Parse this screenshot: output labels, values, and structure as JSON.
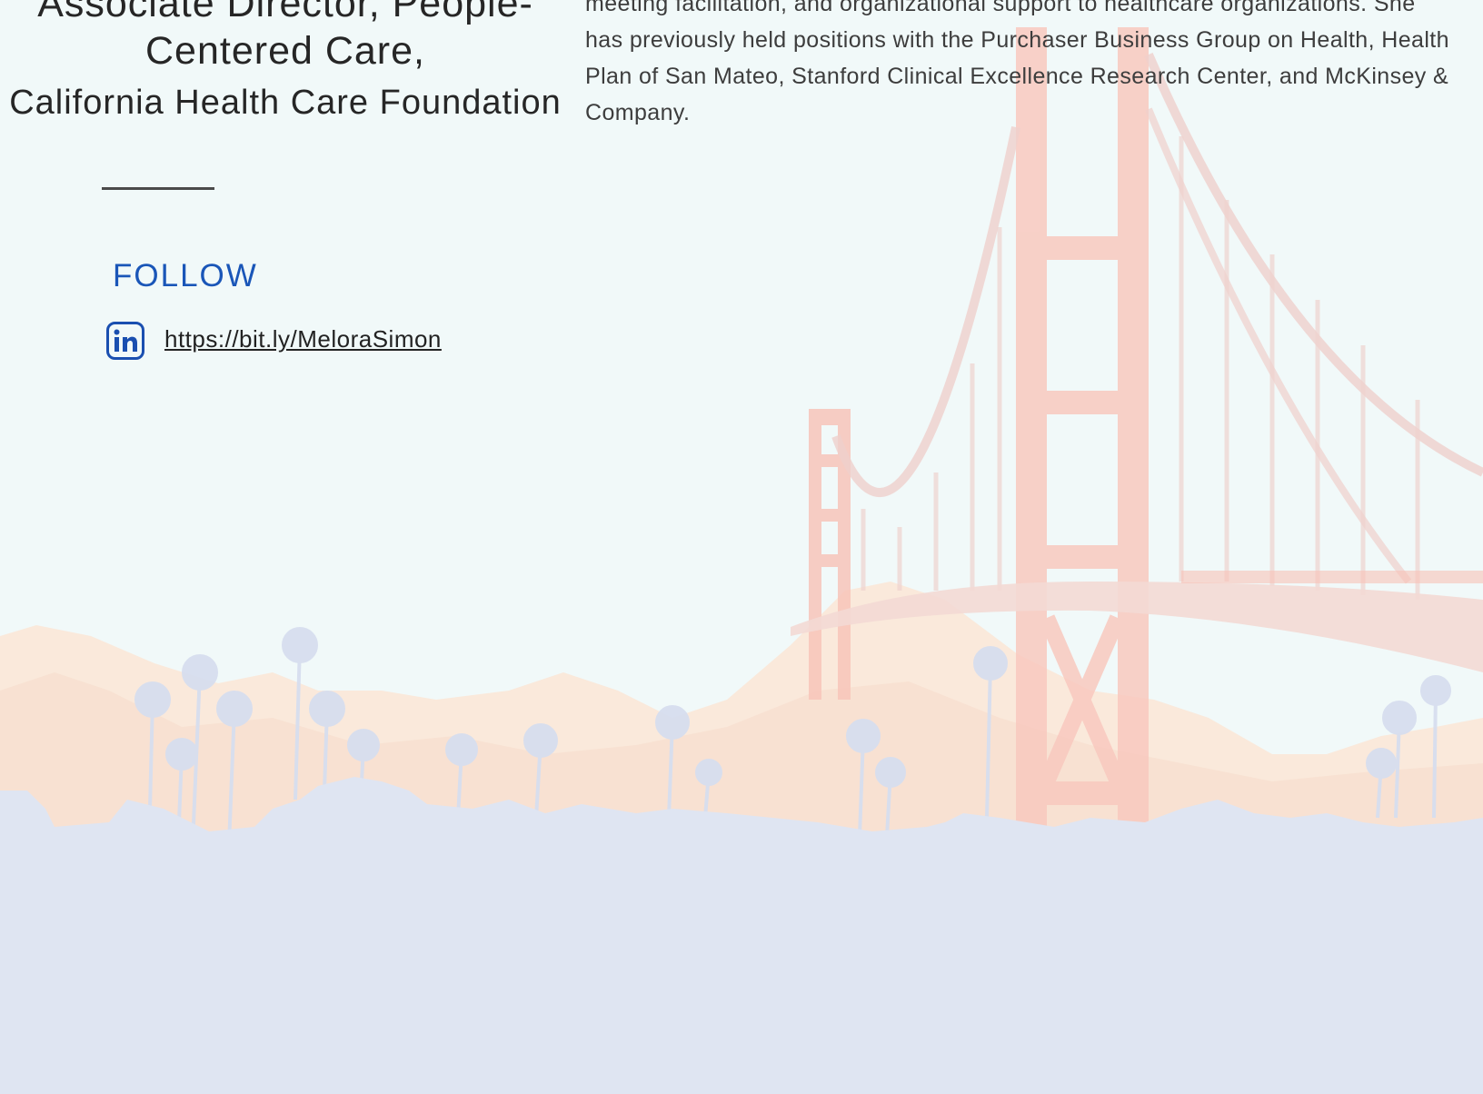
{
  "profile": {
    "role_title": "Associate Director, People-Centered Care,",
    "organization": "California Health Care Foundation"
  },
  "follow": {
    "heading": "FOLLOW",
    "linkedin_url": "https://bit.ly/MeloraSimon",
    "icon": "linkedin-icon"
  },
  "bio": {
    "text": "meeting facilitation, and organizational support to healthcare organizations. She has previously held positions with the Purchaser Business Group on Health, Health Plan of San Mateo, Stanford Clinical Excellence Research Center, and McKinsey & Company."
  },
  "colors": {
    "page_bg": "#f1f9f9",
    "accent_blue": "#1a56b8",
    "bridge": "#f7b8ad",
    "skyline": "#dfe5f2",
    "hills": "#fbe6d6"
  }
}
